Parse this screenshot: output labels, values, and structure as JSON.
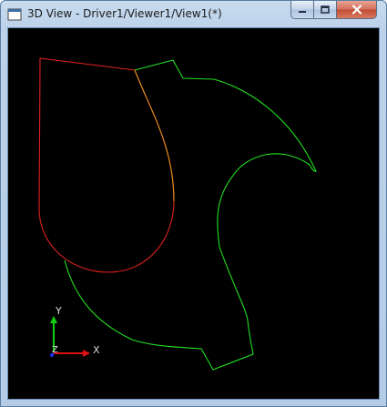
{
  "window": {
    "title": "3D View - Driver1/Viewer1/View1(*)",
    "icon": "app-window-icon",
    "controls": {
      "minimize_icon": "minimize-icon",
      "maximize_icon": "maximize-icon",
      "close_icon": "close-icon"
    }
  },
  "viewport": {
    "background": "#000000",
    "shapes": [
      {
        "name": "red-wire",
        "color": "#e0221e"
      },
      {
        "name": "green-wire",
        "color": "#22e022"
      },
      {
        "name": "orange-edge",
        "color": "#e08a1e"
      }
    ]
  },
  "triad": {
    "x_label": "X",
    "y_label": "Y",
    "z_label": "Z",
    "x_color": "#e01010",
    "y_color": "#10d010",
    "z_color": "#2030e0"
  }
}
